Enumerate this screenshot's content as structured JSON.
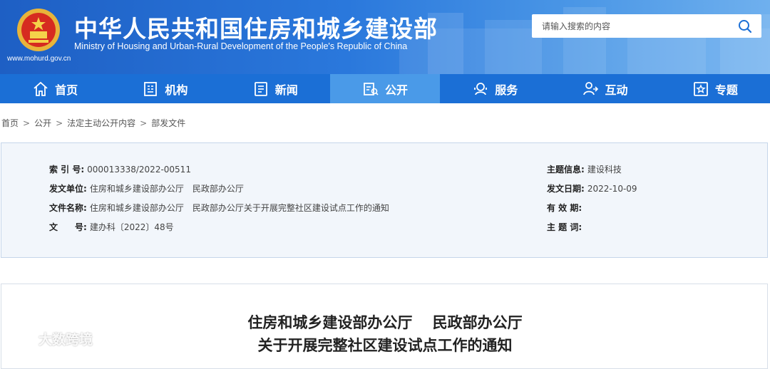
{
  "header": {
    "title_cn": "中华人民共和国住房和城乡建设部",
    "title_en": "Ministry of Housing and Urban-Rural Development of the People's Republic of China",
    "site_url": "www.mohurd.gov.cn",
    "emblem_icon": "national-emblem-icon"
  },
  "search": {
    "placeholder": "请输入搜索的内容",
    "icon": "search-icon"
  },
  "nav": {
    "items": [
      {
        "label": "首页",
        "icon": "home-icon"
      },
      {
        "label": "机构",
        "icon": "building-icon"
      },
      {
        "label": "新闻",
        "icon": "news-icon"
      },
      {
        "label": "公开",
        "icon": "open-docs-icon",
        "active": true
      },
      {
        "label": "服务",
        "icon": "service-icon"
      },
      {
        "label": "互动",
        "icon": "interaction-icon"
      },
      {
        "label": "专题",
        "icon": "topic-icon"
      }
    ]
  },
  "breadcrumb": [
    "首页",
    "公开",
    "法定主动公开内容",
    "部发文件"
  ],
  "meta": {
    "index_no": {
      "label": "索 引 号:",
      "value": "000013338/2022-00511"
    },
    "issuer": {
      "label": "发文单位:",
      "value": "住房和城乡建设部办公厅　民政部办公厅"
    },
    "doc_name": {
      "label": "文件名称:",
      "value": "住房和城乡建设部办公厅　民政部办公厅关于开展完整社区建设试点工作的通知"
    },
    "doc_no": {
      "label": "文　　号:",
      "value": "建办科〔2022〕48号"
    },
    "topic": {
      "label": "主题信息:",
      "value": "建设科技"
    },
    "date": {
      "label": "发文日期:",
      "value": "2022-10-09"
    },
    "validity": {
      "label": "有 效 期:",
      "value": ""
    },
    "keywords": {
      "label": "主 题 词:",
      "value": ""
    }
  },
  "article": {
    "title_line1": "住房和城乡建设部办公厅　 民政部办公厅",
    "title_line2": "关于开展完整社区建设试点工作的通知"
  },
  "watermark": {
    "text": "大数跨境"
  },
  "colors": {
    "nav_bg": "#1b6fd6",
    "nav_active": "#4a9ae8",
    "meta_bg": "#f2f6fb"
  }
}
